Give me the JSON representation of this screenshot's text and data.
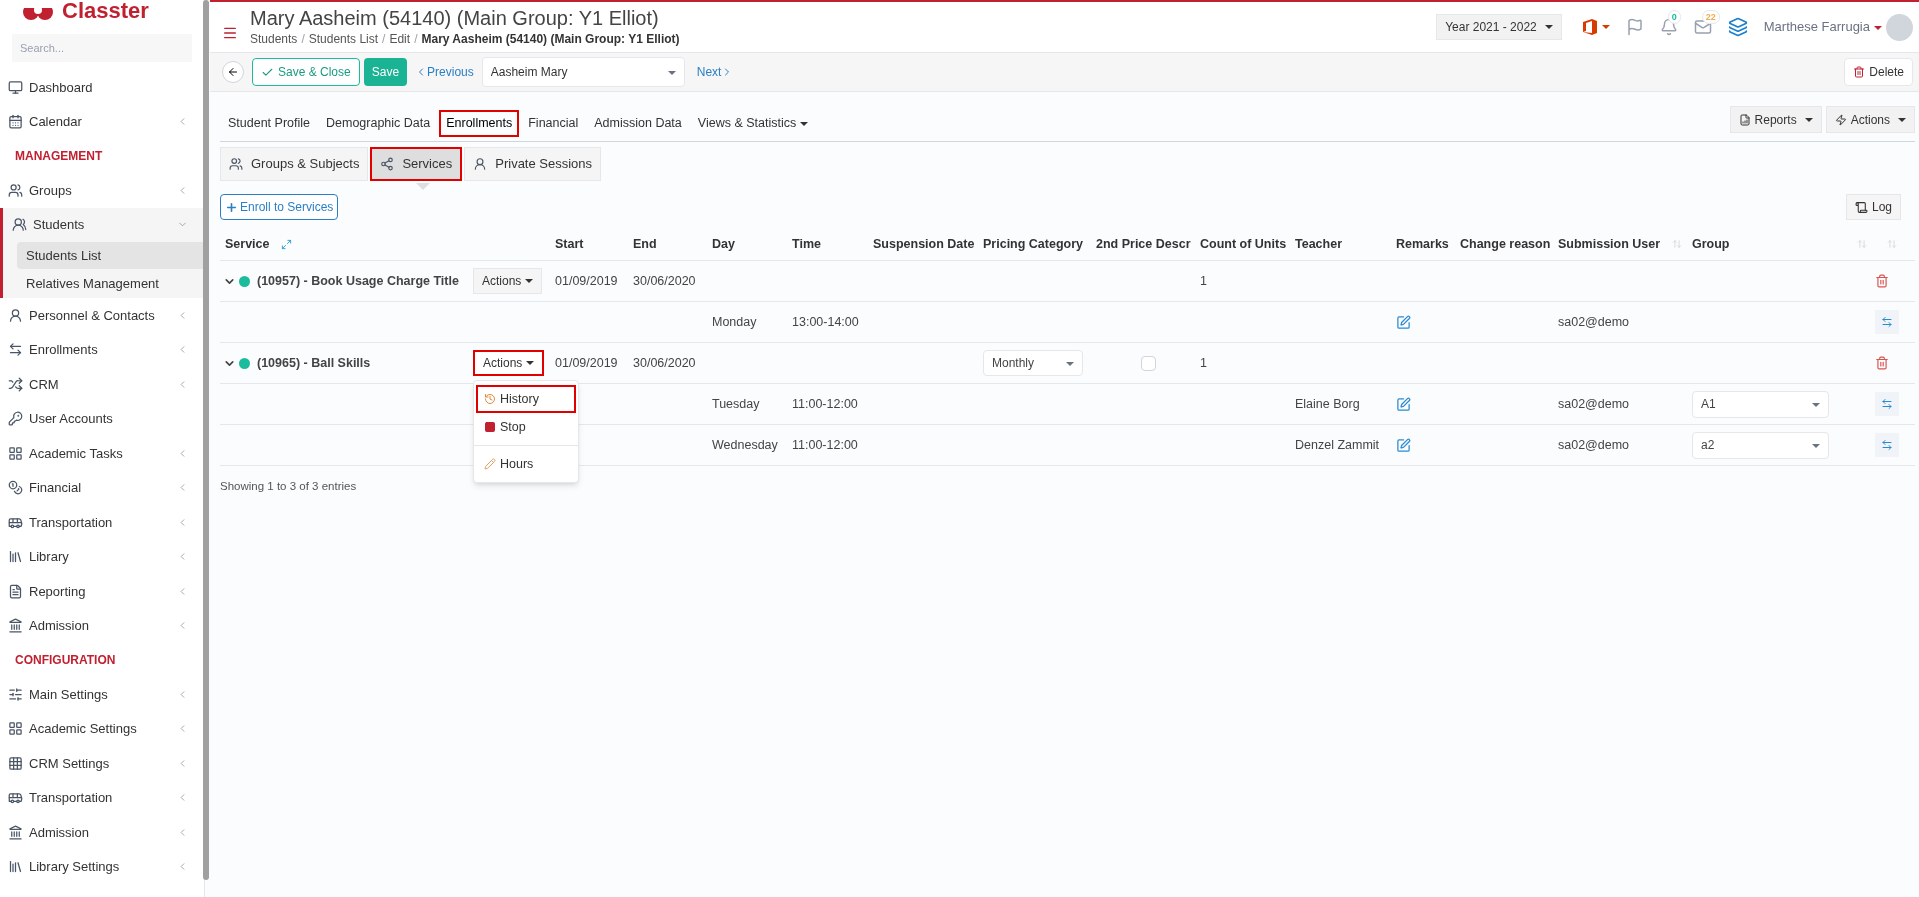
{
  "sidebar": {
    "logo": "Classter",
    "search": {
      "placeholder": "Search..."
    },
    "nav": [
      {
        "kind": "item",
        "label": "Dashboard"
      },
      {
        "kind": "item",
        "label": "Calendar",
        "expanded": false
      },
      {
        "kind": "heading",
        "label": "MANAGEMENT"
      },
      {
        "kind": "item",
        "label": "Groups",
        "expanded": false
      },
      {
        "kind": "item",
        "label": "Students",
        "expanded": true,
        "children": [
          {
            "label": "Students List",
            "selected": true
          },
          {
            "label": "Relatives Management",
            "selected": false
          }
        ]
      },
      {
        "kind": "item",
        "label": "Personnel & Contacts",
        "expanded": false
      },
      {
        "kind": "item",
        "label": "Enrollments",
        "expanded": false
      },
      {
        "kind": "item",
        "label": "CRM",
        "expanded": false
      },
      {
        "kind": "item",
        "label": "User Accounts"
      },
      {
        "kind": "item",
        "label": "Academic Tasks",
        "expanded": false
      },
      {
        "kind": "item",
        "label": "Financial",
        "expanded": false
      },
      {
        "kind": "item",
        "label": "Transportation",
        "expanded": false
      },
      {
        "kind": "item",
        "label": "Library",
        "expanded": false
      },
      {
        "kind": "item",
        "label": "Reporting",
        "expanded": false
      },
      {
        "kind": "item",
        "label": "Admission",
        "expanded": false
      },
      {
        "kind": "heading",
        "label": "CONFIGURATION"
      },
      {
        "kind": "item",
        "label": "Main Settings",
        "expanded": false
      },
      {
        "kind": "item",
        "label": "Academic Settings",
        "expanded": false
      },
      {
        "kind": "item",
        "label": "CRM Settings",
        "expanded": false
      },
      {
        "kind": "item",
        "label": "Transportation",
        "expanded": false
      },
      {
        "kind": "item",
        "label": "Admission",
        "expanded": false
      },
      {
        "kind": "item",
        "label": "Library Settings",
        "expanded": false
      }
    ]
  },
  "header": {
    "title": "Mary Aasheim (54140) (Main Group: Y1 Elliot)",
    "breadcrumbs": [
      "Students",
      "Students List",
      "Edit",
      "Mary Aasheim (54140) (Main Group: Y1 Elliot)"
    ],
    "breadcrumb_separator": "/",
    "year": "Year 2021 - 2022",
    "notifications": "0",
    "messages": "22",
    "user": "Marthese Farrugia"
  },
  "toolbar": {
    "save_close": "Save & Close",
    "save": "Save",
    "previous": "Previous",
    "student": "Aasheim Mary",
    "next": "Next",
    "delete": "Delete"
  },
  "tabs": [
    {
      "label": "Student Profile",
      "selected": false,
      "highlighted": false
    },
    {
      "label": "Demographic Data",
      "selected": false,
      "highlighted": false
    },
    {
      "label": "Enrollments",
      "selected": true,
      "highlighted": true
    },
    {
      "label": "Financial",
      "selected": false,
      "highlighted": false
    },
    {
      "label": "Admission Data",
      "selected": false,
      "highlighted": false
    },
    {
      "label": "Views & Statistics",
      "selected": false,
      "highlighted": false,
      "kind": "dropdown"
    }
  ],
  "tab_actions": [
    "Reports",
    "Actions"
  ],
  "subtabs": [
    {
      "label": "Groups & Subjects",
      "selected": false,
      "highlighted": false
    },
    {
      "label": "Services",
      "selected": true,
      "highlighted": true
    },
    {
      "label": "Private Sessions",
      "selected": false,
      "highlighted": false
    }
  ],
  "enroll_button": "Enroll to Services",
  "log_button": "Log",
  "table": {
    "columns": [
      "Service",
      "Start",
      "End",
      "Day",
      "Time",
      "Suspension Date",
      "Pricing Category",
      "2nd Price Descr",
      "Count of Units",
      "Teacher",
      "Remarks",
      "Change reason",
      "Submission User",
      "Group"
    ],
    "rows": [
      {
        "kind": "service",
        "expanded": true,
        "color": "#1abc9c",
        "name": "(10957) - Book Usage Charge Title",
        "actions": "Actions",
        "actions_highlighted": false,
        "start": "01/09/2019",
        "end": "30/06/2020",
        "count": "1"
      },
      {
        "kind": "schedule",
        "day": "Monday",
        "time": "13:00-14:00",
        "submission_user": "sa02@demo"
      },
      {
        "kind": "service",
        "expanded": true,
        "color": "#1abc9c",
        "name": "(10965) - Ball Skills",
        "actions": "Actions",
        "actions_highlighted": true,
        "start": "01/09/2019",
        "end": "30/06/2020",
        "pricing": "Monthly",
        "second_price_checked": false,
        "count": "1",
        "menu": [
          {
            "kind": "history",
            "label": "History",
            "highlighted": true
          },
          {
            "kind": "stop",
            "label": "Stop",
            "highlighted": false
          },
          {
            "kind": "hours",
            "label": "Hours",
            "highlighted": false
          }
        ]
      },
      {
        "kind": "schedule",
        "day": "Tuesday",
        "time": "11:00-12:00",
        "teacher": "Elaine Borg",
        "submission_user": "sa02@demo",
        "group": "A1"
      },
      {
        "kind": "schedule",
        "day": "Wednesday",
        "time": "11:00-12:00",
        "teacher": "Denzel Zammit",
        "submission_user": "sa02@demo",
        "group": "a2"
      }
    ],
    "footer": "Showing 1 to 3 of 3 entries"
  }
}
